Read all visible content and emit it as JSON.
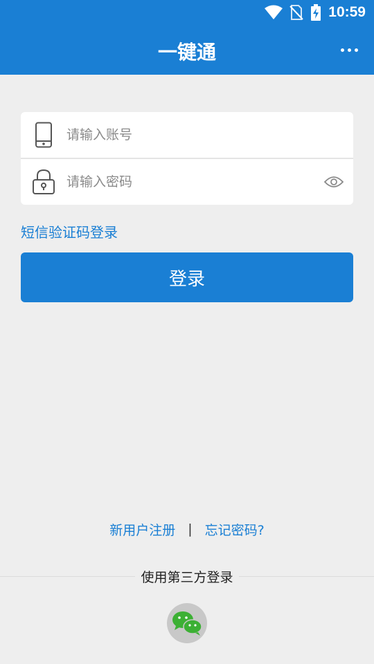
{
  "status_bar": {
    "time": "10:59"
  },
  "app_bar": {
    "title": "一键通"
  },
  "form": {
    "account_placeholder": "请输入账号",
    "password_placeholder": "请输入密码"
  },
  "sms_login_label": "短信验证码登录",
  "login_button_label": "登录",
  "links": {
    "register": "新用户注册",
    "separator": "|",
    "forgot_password": "忘记密码?"
  },
  "third_party": {
    "title": "使用第三方登录"
  },
  "colors": {
    "primary": "#1a7fd4",
    "background": "#eeeeee",
    "wechat_green": "#3cb034"
  },
  "icons": [
    "wifi-icon",
    "no-sim-icon",
    "battery-charging-icon",
    "more-icon",
    "phone-icon",
    "lock-icon",
    "eye-icon",
    "wechat-icon"
  ]
}
